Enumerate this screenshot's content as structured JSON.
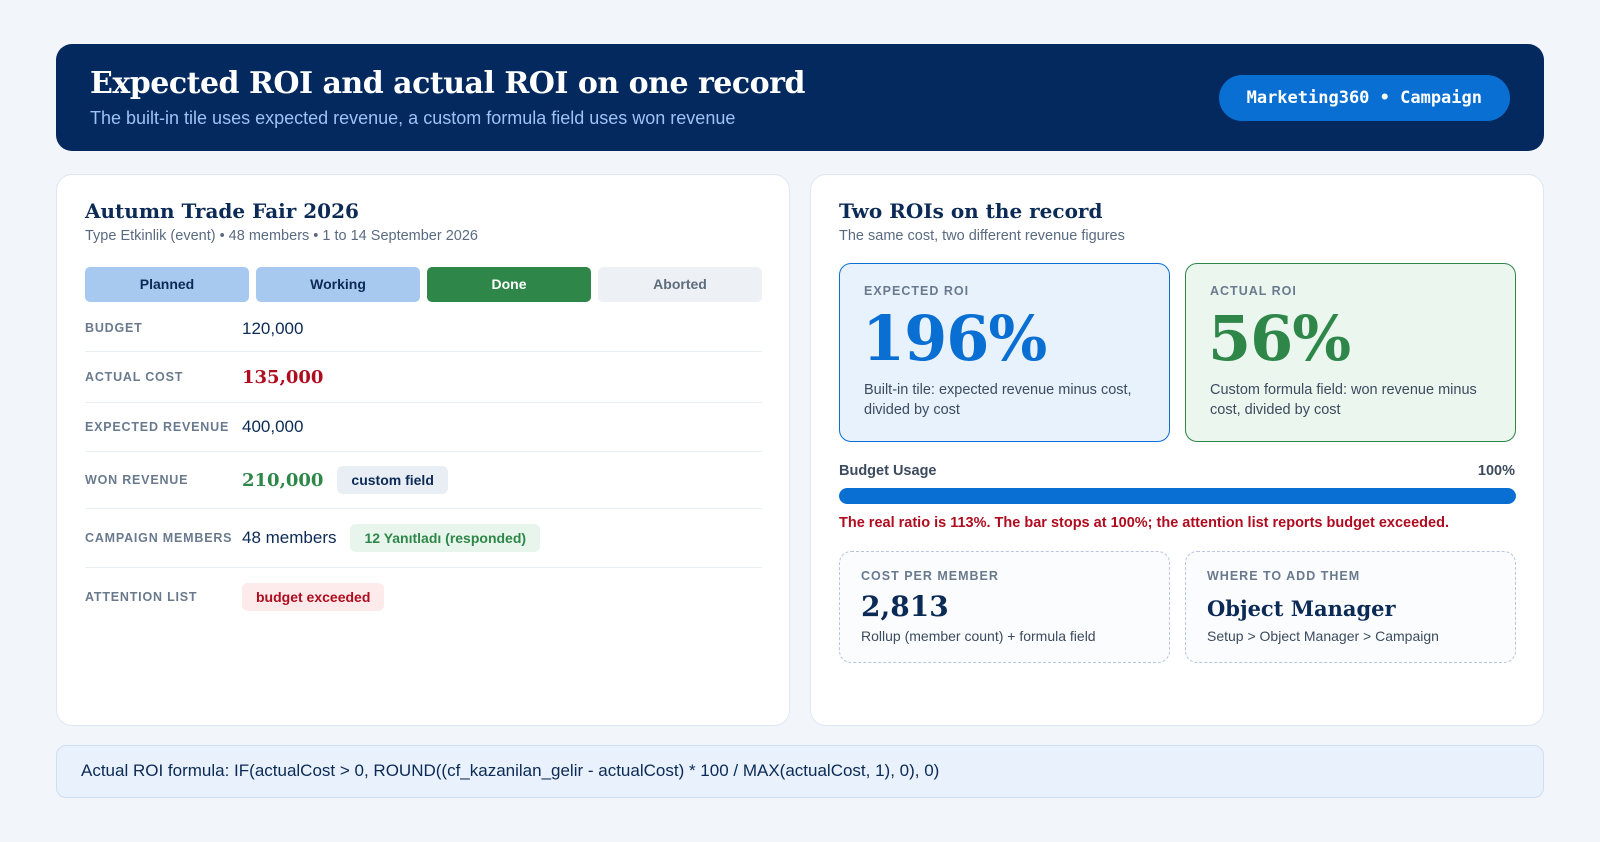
{
  "header": {
    "title": "Expected ROI and actual ROI on one record",
    "subtitle": "The built-in tile uses expected revenue, a custom formula field uses won revenue",
    "badge": "Marketing360 • Campaign"
  },
  "campaign": {
    "title": "Autumn Trade Fair 2026",
    "meta": "Type Etkinlik (event) • 48 members • 1 to 14 September 2026",
    "stages": [
      {
        "label": "Planned",
        "state": "past"
      },
      {
        "label": "Working",
        "state": "past"
      },
      {
        "label": "Done",
        "state": "current"
      },
      {
        "label": "Aborted",
        "state": "inactive"
      }
    ],
    "fields": {
      "budget": {
        "label": "BUDGET",
        "value": "120,000"
      },
      "actual_cost": {
        "label": "ACTUAL COST",
        "value": "135,000"
      },
      "expected_revenue": {
        "label": "EXPECTED REVENUE",
        "value": "400,000"
      },
      "won_revenue": {
        "label": "WON REVENUE",
        "value": "210,000",
        "tag": "custom field"
      },
      "members": {
        "label": "CAMPAIGN MEMBERS",
        "value": "48 members",
        "tag": "12 Yanıtladı (responded)"
      },
      "attention": {
        "label": "ATTENTION LIST",
        "tag": "budget exceeded"
      }
    }
  },
  "roi": {
    "title": "Two ROIs on the record",
    "subtitle": "The same cost, two different revenue figures",
    "expected": {
      "label": "EXPECTED ROI",
      "value": "196%",
      "description": "Built-in tile: expected revenue minus cost, divided by cost"
    },
    "actual": {
      "label": "ACTUAL ROI",
      "value": "56%",
      "description": "Custom formula field: won revenue minus cost, divided by cost"
    },
    "budget_usage": {
      "label": "Budget Usage",
      "percent_text": "100%",
      "fill_fraction": 1.0,
      "note": "The real ratio is 113%. The bar stops at 100%; the attention list reports budget exceeded."
    },
    "cost_per_member": {
      "label": "COST PER MEMBER",
      "value": "2,813",
      "description": "Rollup (member count) + formula field"
    },
    "where_to_add": {
      "label": "WHERE TO ADD THEM",
      "value": "Object Manager",
      "description": "Setup > Object Manager > Campaign"
    }
  },
  "formula": {
    "text": "Actual ROI formula: IF(actualCost > 0, ROUND((cf_kazanilan_gelir - actualCost) * 100 / MAX(actualCost, 1), 0), 0)"
  },
  "colors": {
    "header_bg": "#03295e",
    "accent_blue": "#0a6fd3",
    "success_green": "#2e8749",
    "danger_red": "#b00c1f"
  }
}
